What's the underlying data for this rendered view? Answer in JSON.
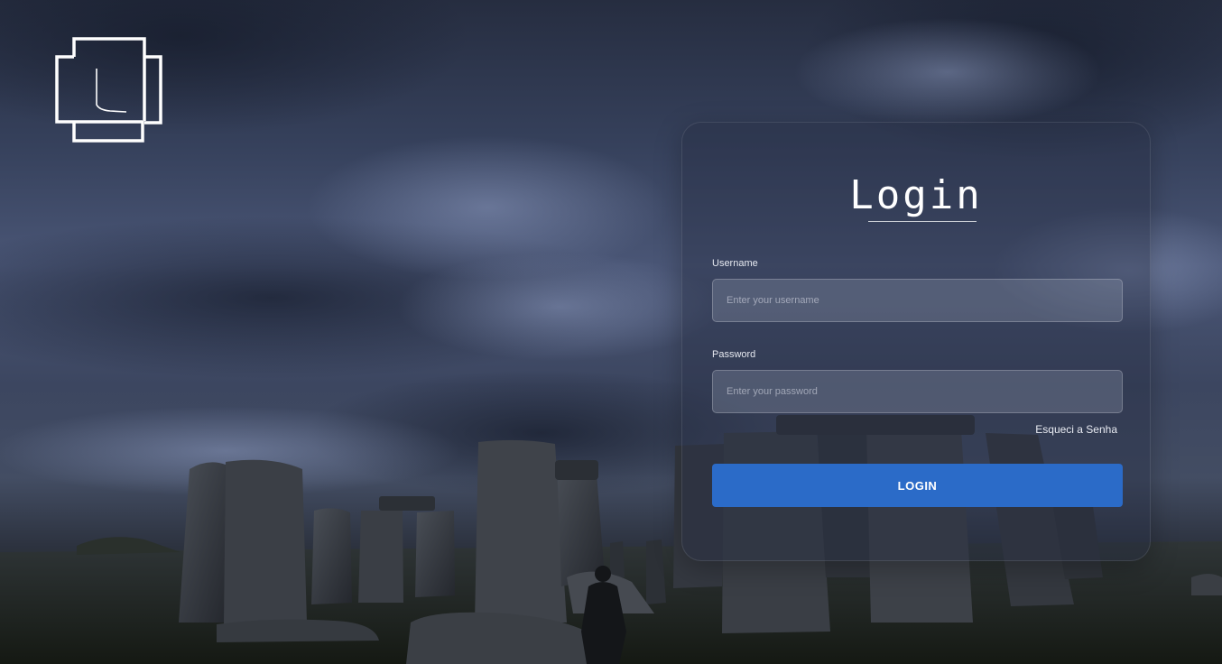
{
  "login": {
    "title": "Login",
    "username_label": "Username",
    "username_placeholder": "Enter your username",
    "password_label": "Password",
    "password_placeholder": "Enter your password",
    "forgot_password": "Esqueci a Senha",
    "submit_label": "LOGIN"
  },
  "brand": {
    "logo_icon": "layered-squares-L-logo"
  },
  "colors": {
    "accent": "#2b6bc8",
    "text": "#ffffff",
    "night_sky": "#36415c"
  }
}
